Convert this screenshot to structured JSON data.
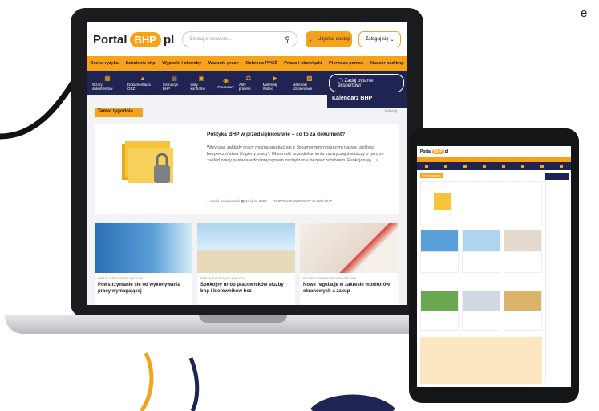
{
  "corner_text": "e",
  "site": {
    "logo_left": "Portal",
    "logo_badge": "BHP",
    "logo_right": "pl",
    "search_placeholder": "Szukaj w serwisie...",
    "access_button": "Uzyskaj dostęp",
    "login_button": "Zaloguj się",
    "menu": [
      "Ocena ryzyka",
      "Szkolenia bhp",
      "Wypadki i choroby",
      "Warunki pracy",
      "Ochrona PPOŻ",
      "Prawa i obowiązki",
      "Pierwsza pomoc",
      "Nadzór nad bhp"
    ],
    "tools": [
      "Wzory dokumentów",
      "Dokumentacja OSZ",
      "Instrukcje BHP",
      "Listy kontrolne",
      "Procedury",
      "Akty prawne",
      "Materiały Wideo",
      "Materiały szkoleniowe"
    ],
    "ask_button": "Zadaj pytanie ekspertowi",
    "section_label": "Temat tygodnia",
    "more_label": "Więcej",
    "calendar_label": "Kalendarz BHP",
    "calendar_more": "Więcej",
    "featured": {
      "title": "Polityka BHP w przedsiębiorstwie – co to za dokument?",
      "text": "Wizytując zakłady pracy można spotkać się z dokumentem noszącym nazwę „polityka bezpieczeństwa i higieny pracy”. Obecność tego dokumentu zazwyczaj świadczy o tym, że zakład pracy posiada wdrożony system zarządzania bezpieczeństwem. Funkcjonują... »",
      "author": "Kamil Sczabiewski",
      "date": "18 lipca 2022",
      "category": "ROZWÓJ ZAWODOWY SŁUŻB BHP"
    },
    "cards": [
      {
        "category": "BHP DLA POCZĄTKUJĄCYCH",
        "title": "Powstrzymanie się od wykonywania pracy wymagającej"
      },
      {
        "category": "BHP DLA POCZĄTKUJĄCYCH",
        "title": "Spokojny urlop pracowników służby bhp i kierowników bez"
      },
      {
        "category": "ROZWÓJ ZAWODOWY SŁUŻB BHP",
        "title": "Nowe regulacje w zakresie monitorów ekranowych a zakup"
      }
    ]
  },
  "colors": {
    "accent": "#f7a21b",
    "navy": "#202452"
  }
}
